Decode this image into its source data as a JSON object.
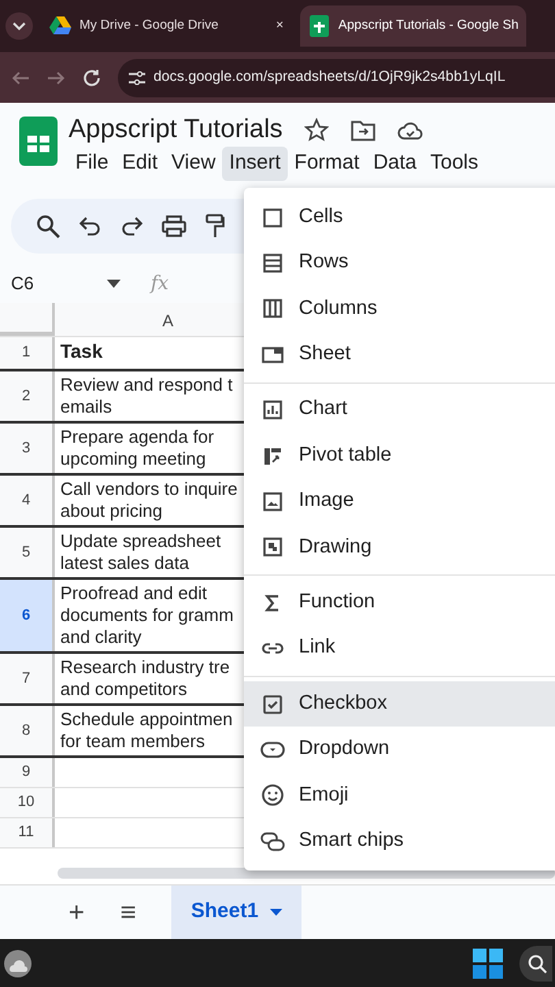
{
  "browser_tabs": [
    {
      "title": "My Drive - Google Drive",
      "close": "×",
      "selected": false,
      "kind": "drive"
    },
    {
      "title": "Appscript Tutorials - Google Sh",
      "selected": true,
      "kind": "sheets"
    }
  ],
  "address_bar": {
    "url": "docs.google.com/spreadsheets/d/1OjR9jk2s4bb1yLqIL"
  },
  "document": {
    "title": "Appscript Tutorials"
  },
  "menu_bar": [
    {
      "label": "File",
      "selected": false
    },
    {
      "label": "Edit",
      "selected": false
    },
    {
      "label": "View",
      "selected": false
    },
    {
      "label": "Insert",
      "selected": true
    },
    {
      "label": "Format",
      "selected": false
    },
    {
      "label": "Data",
      "selected": false
    },
    {
      "label": "Tools",
      "selected": false
    }
  ],
  "formula_bar": {
    "cell_ref": "C6",
    "fx": "fx"
  },
  "grid": {
    "columns": [
      "A"
    ],
    "rows": [
      {
        "number": "1",
        "cell": "Task",
        "bold": true,
        "selected": false
      },
      {
        "number": "2",
        "cell": "Review and respond t\nemails",
        "bold": false,
        "selected": false
      },
      {
        "number": "3",
        "cell": "Prepare agenda for\nupcoming meeting",
        "bold": false,
        "selected": false
      },
      {
        "number": "4",
        "cell": "Call vendors to inquire\nabout pricing",
        "bold": false,
        "selected": false
      },
      {
        "number": "5",
        "cell": "Update spreadsheet\nlatest sales data",
        "bold": false,
        "selected": false
      },
      {
        "number": "6",
        "cell": "Proofread and edit\ndocuments for gramm\nand clarity",
        "bold": false,
        "selected": true
      },
      {
        "number": "7",
        "cell": "Research industry tre\nand competitors",
        "bold": false,
        "selected": false
      },
      {
        "number": "8",
        "cell": "Schedule appointmen\nfor team members",
        "bold": false,
        "selected": false
      },
      {
        "number": "9",
        "selected": false
      },
      {
        "number": "10",
        "selected": false
      },
      {
        "number": "11",
        "selected": false
      }
    ]
  },
  "sheet_bar": {
    "add": "+",
    "list": "≡",
    "sheets": [
      {
        "label": "Sheet1",
        "selected": true
      }
    ]
  },
  "insert_menu": [
    [
      {
        "label": "Cells",
        "kind": "cells",
        "selected": false
      },
      {
        "label": "Rows",
        "kind": "rows",
        "selected": false
      },
      {
        "label": "Columns",
        "kind": "columns",
        "selected": false
      },
      {
        "label": "Sheet",
        "kind": "sheet",
        "selected": false
      }
    ],
    [
      {
        "label": "Chart",
        "kind": "chart",
        "selected": false
      },
      {
        "label": "Pivot table",
        "kind": "pivot",
        "selected": false
      },
      {
        "label": "Image",
        "kind": "image",
        "selected": false
      },
      {
        "label": "Drawing",
        "kind": "drawing",
        "selected": false
      }
    ],
    [
      {
        "label": "Function",
        "kind": "function",
        "selected": false
      },
      {
        "label": "Link",
        "kind": "link",
        "selected": false
      }
    ],
    [
      {
        "label": "Checkbox",
        "kind": "checkbox",
        "selected": true
      },
      {
        "label": "Dropdown",
        "kind": "dropdown",
        "selected": false
      },
      {
        "label": "Emoji",
        "kind": "emoji",
        "selected": false
      },
      {
        "label": "Smart chips",
        "kind": "chips",
        "selected": false
      }
    ]
  ]
}
